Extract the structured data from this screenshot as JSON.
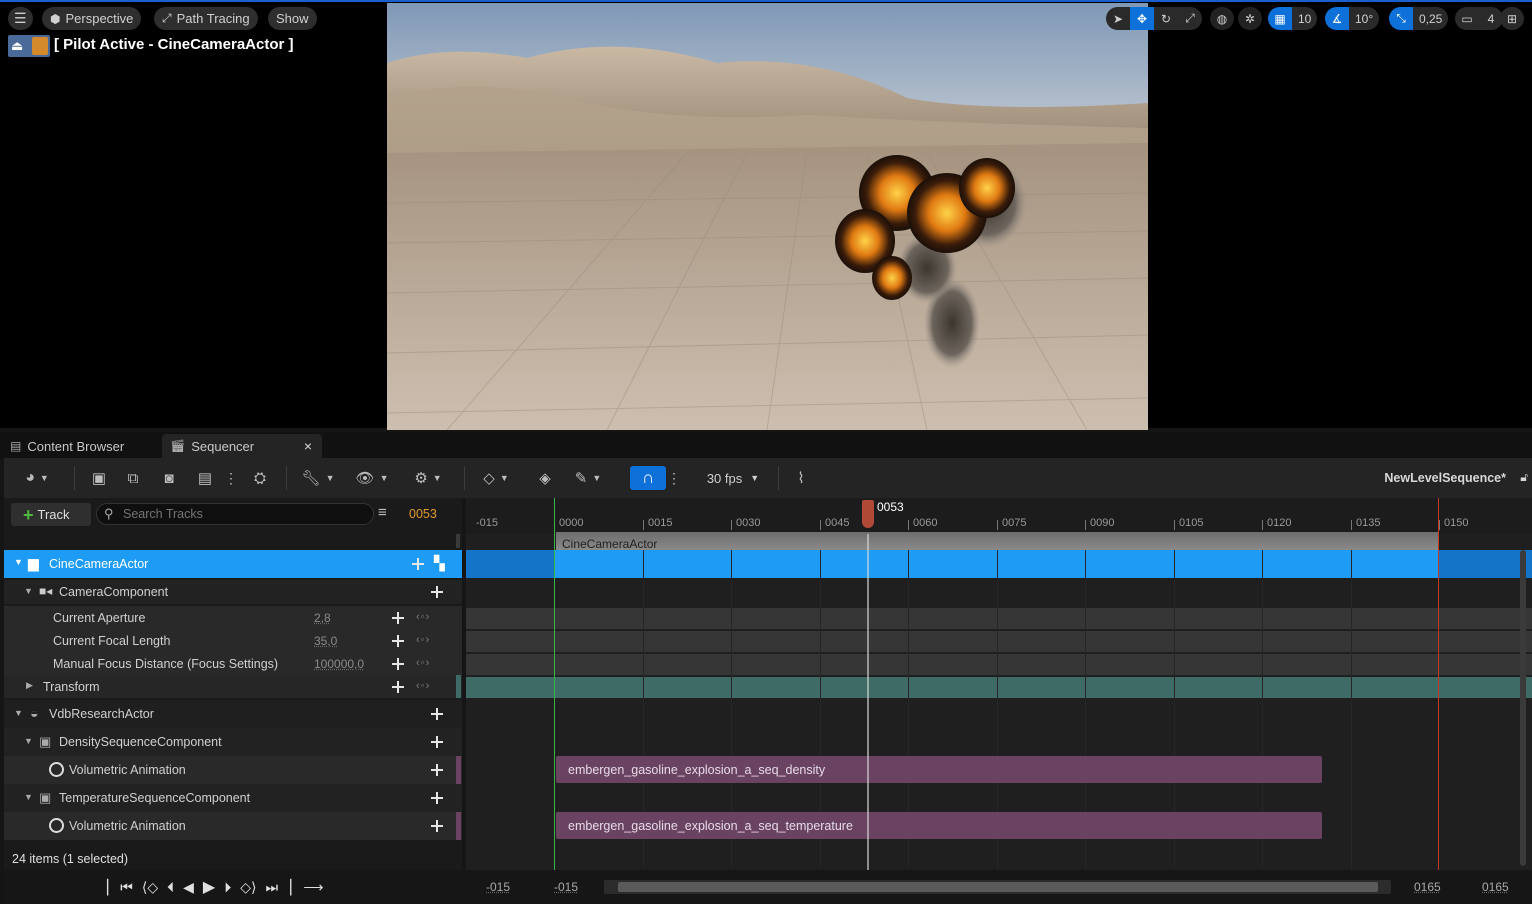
{
  "viewport": {
    "menu_label": "",
    "perspective_label": "Perspective",
    "path_tracing_label": "Path Tracing",
    "show_label": "Show",
    "pilot_label": "[ Pilot Active - CineCameraActor ]",
    "grid_value": "10",
    "angle_value": "10°",
    "scale_value": "0,25",
    "camera_speed": "4"
  },
  "tabs": {
    "content_browser": "Content Browser",
    "sequencer": "Sequencer",
    "close": "×"
  },
  "toolbar": {
    "fps": "30 fps",
    "sequence_name": "NewLevelSequence*"
  },
  "tracks_header": {
    "add_track": "Track",
    "search_placeholder": "Search Tracks",
    "current_frame": "0053"
  },
  "tracks": {
    "cine_actor": "CineCameraActor",
    "camera_component": "CameraComponent",
    "aperture_label": "Current Aperture",
    "aperture_value": "2,8",
    "focal_label": "Current Focal Length",
    "focal_value": "35,0",
    "focus_label": "Manual Focus Distance (Focus Settings)",
    "focus_value": "100000,0",
    "transform": "Transform",
    "vdb_actor": "VdbResearchActor",
    "density_component": "DensitySequenceComponent",
    "vol_anim_1": "Volumetric Animation",
    "temperature_component": "TemperatureSequenceComponent",
    "vol_anim_2": "Volumetric Animation",
    "item_count": "24 items (1 selected)"
  },
  "timeline": {
    "playhead_label": "0053",
    "ticks": [
      "-015",
      "0000",
      "0015",
      "0030",
      "0045",
      "0060",
      "0075",
      "0090",
      "0105",
      "0120",
      "0135",
      "0150"
    ],
    "camera_cut_label": "CineCameraActor",
    "density_section": "embergen_gasoline_explosion_a_seq_density",
    "temperature_section": "embergen_gasoline_explosion_a_seq_temperature"
  },
  "bottom": {
    "range_start_outer": "-015",
    "range_start_inner": "-015",
    "range_end_inner": "0165",
    "range_end_outer": "0165"
  },
  "colors": {
    "selection_blue": "#1e9cf5",
    "accent_blue": "#0e70d9",
    "transform_teal": "#3f6b66",
    "section_purple": "#6a4262",
    "playhead": "#c0503a"
  }
}
